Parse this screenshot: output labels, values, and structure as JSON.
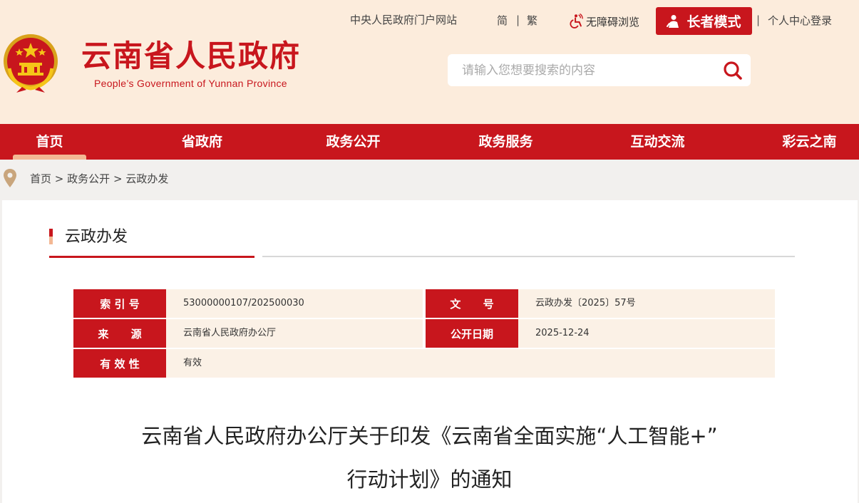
{
  "header": {
    "site_title": "云南省人民政府",
    "site_subtitle": "People’s Government of Yunnan Province",
    "links": {
      "central_portal": "中央人民政府门户网站",
      "simplified": "简",
      "separator": "|",
      "traditional": "繁",
      "accessibility": "无障碍浏览",
      "elder_mode": "长者模式",
      "login": "个人中心登录"
    },
    "search": {
      "placeholder": "请输入您想要搜索的内容",
      "value": ""
    }
  },
  "nav": {
    "items": [
      {
        "label": "首页",
        "active": true
      },
      {
        "label": "省政府"
      },
      {
        "label": "政务公开"
      },
      {
        "label": "政务服务"
      },
      {
        "label": "互动交流"
      },
      {
        "label": "彩云之南"
      }
    ]
  },
  "breadcrumb": {
    "items": [
      "首页",
      "政务公开",
      "云政办发"
    ],
    "separator": ">"
  },
  "section": {
    "title": "云政办发"
  },
  "meta": {
    "index_label": "索 引 号",
    "index_value": "53000000107/202500030",
    "docno_label": "文      号",
    "docno_value": "云政办发〔2025〕57号",
    "source_label": "来      源",
    "source_value": "云南省人民政府办公厅",
    "date_label": "公开日期",
    "date_value": "2025-12-24",
    "validity_label": "有 效 性",
    "validity_value": "有效"
  },
  "document": {
    "title_line1": "云南省人民政府办公厅关于印发《云南省全面实施“人工智能+”",
    "title_line2": "行动计划》的通知"
  },
  "colors": {
    "brand_red": "#c8161d",
    "header_bg": "#fcecdc",
    "accent_peach": "#f3b894",
    "meta_row_bg": "#fbf1e6"
  }
}
